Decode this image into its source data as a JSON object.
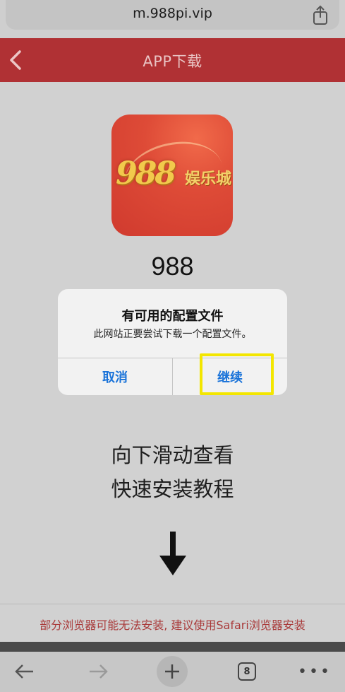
{
  "browser": {
    "url": "m.988pi.vip",
    "tab_count": "8",
    "share_icon": "share-icon",
    "toolbar_icons": [
      "back-arrow-icon",
      "forward-arrow-icon",
      "plus-icon",
      "tabs-icon",
      "more-icon"
    ],
    "more_label": "•••"
  },
  "header": {
    "title": "APP下载",
    "back_icon": "chevron-left-icon",
    "color": "#b03134"
  },
  "app": {
    "logo_number": "988",
    "logo_text": "娱乐城",
    "name": "988"
  },
  "alert": {
    "title": "有可用的配置文件",
    "message": "此网站正要尝试下载一个配置文件。",
    "cancel_label": "取消",
    "continue_label": "继续",
    "button_color": "#1a73d9"
  },
  "content": {
    "scroll_hint_line1": "向下滑动查看",
    "scroll_hint_line2": "快速安装教程",
    "footer_note": "部分浏览器可能无法安装, 建议使用Safari浏览器安装"
  },
  "annotation": {
    "highlight_color": "#f3e600"
  }
}
